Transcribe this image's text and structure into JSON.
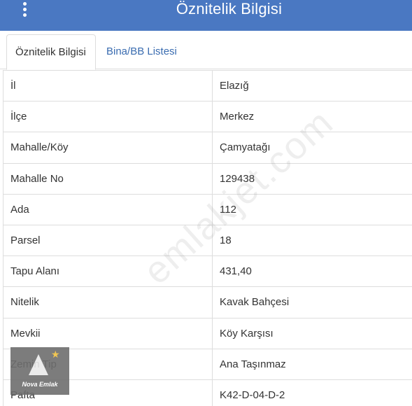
{
  "header": {
    "title": "Öznitelik Bilgisi"
  },
  "tabs": [
    {
      "label": "Öznitelik Bilgisi",
      "active": true
    },
    {
      "label": "Bina/BB Listesi",
      "active": false
    }
  ],
  "attributes": [
    {
      "label": "İl",
      "value": "Elazığ"
    },
    {
      "label": "İlçe",
      "value": "Merkez"
    },
    {
      "label": "Mahalle/Köy",
      "value": "Çamyatağı"
    },
    {
      "label": "Mahalle No",
      "value": "129438"
    },
    {
      "label": "Ada",
      "value": "112"
    },
    {
      "label": "Parsel",
      "value": "18"
    },
    {
      "label": "Tapu Alanı",
      "value": "431,40"
    },
    {
      "label": "Nitelik",
      "value": "Kavak Bahçesi"
    },
    {
      "label": "Mevkii",
      "value": "Köy Karşısı"
    },
    {
      "label": "Zemin Tip",
      "value": "Ana Taşınmaz"
    },
    {
      "label": "Pafta",
      "value": "K42-D-04-D-2"
    }
  ],
  "watermark": "emlakjet.com",
  "logo": {
    "text": "Nova Emlak"
  },
  "colors": {
    "header_bg": "#4a78c2",
    "tab_link": "#3a6cb0",
    "border": "#dddddd"
  }
}
